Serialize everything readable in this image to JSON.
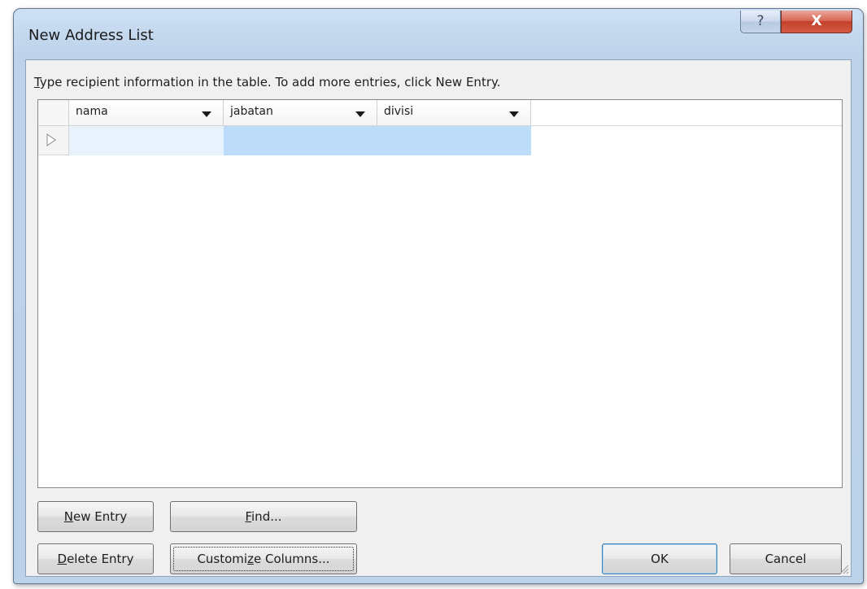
{
  "window": {
    "title": "New Address List",
    "help_label": "?",
    "close_label": "X"
  },
  "instruction": {
    "accel": "T",
    "rest": "ype recipient information in the table.  To add more entries, click New Entry."
  },
  "table": {
    "columns": [
      {
        "label": "nama"
      },
      {
        "label": "jabatan"
      },
      {
        "label": "divisi"
      }
    ],
    "rows": [
      {
        "nama": "",
        "jabatan": "",
        "divisi": ""
      }
    ]
  },
  "buttons": {
    "new_entry": {
      "accel": "N",
      "rest": "ew Entry"
    },
    "find": {
      "accel": "F",
      "rest": "ind..."
    },
    "delete_entry": {
      "accel": "D",
      "rest": "elete Entry"
    },
    "customize_columns": {
      "pre": "Customi",
      "accel": "z",
      "post": "e Columns..."
    },
    "ok": "OK",
    "cancel": "Cancel"
  },
  "icons": {
    "help": "help-icon",
    "close": "close-icon",
    "row_pointer": "row-pointer-icon",
    "dropdown": "chevron-down-icon",
    "grip": "resize-grip-icon"
  }
}
